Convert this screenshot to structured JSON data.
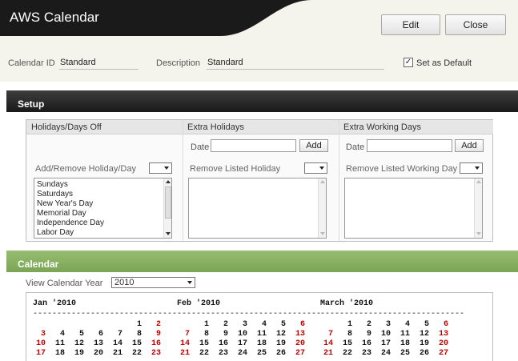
{
  "app": {
    "title": "AWS Calendar"
  },
  "buttons": {
    "edit": "Edit",
    "close": "Close"
  },
  "fields": {
    "calendar_id_label": "Calendar ID",
    "calendar_id_value": "Standard",
    "description_label": "Description",
    "description_value": "Standard",
    "default_label": "Set as Default",
    "default_checked": true
  },
  "setup": {
    "title": "Setup",
    "columns": [
      {
        "header": "Holidays/Days Off",
        "action_label": "Add/Remove Holiday/Day",
        "items": [
          "Sundays",
          "Saturdays",
          "New Year's Day",
          "Memorial Day",
          "Independence Day",
          "Labor Day"
        ]
      },
      {
        "header": "Extra Holidays",
        "date_label": "Date",
        "add_label": "Add",
        "action_label": "Remove Listed Holiday",
        "items": []
      },
      {
        "header": "Extra Working Days",
        "date_label": "Date",
        "add_label": "Add",
        "action_label": "Remove Listed Working Day",
        "items": []
      }
    ]
  },
  "calendar": {
    "title": "Calendar",
    "view_year_label": "View Calendar Year",
    "year": "2010",
    "separator": "------------------------------",
    "months": [
      {
        "name": "Jan '2010",
        "first_weekday": 5,
        "rows_shown": 4
      },
      {
        "name": "Feb '2010",
        "first_weekday": 1,
        "rows_shown": 4
      },
      {
        "name": "March '2010",
        "first_weekday": 1,
        "rows_shown": 4
      }
    ],
    "colors": {
      "weekend": "#c00000",
      "weekday": "#111111"
    }
  }
}
